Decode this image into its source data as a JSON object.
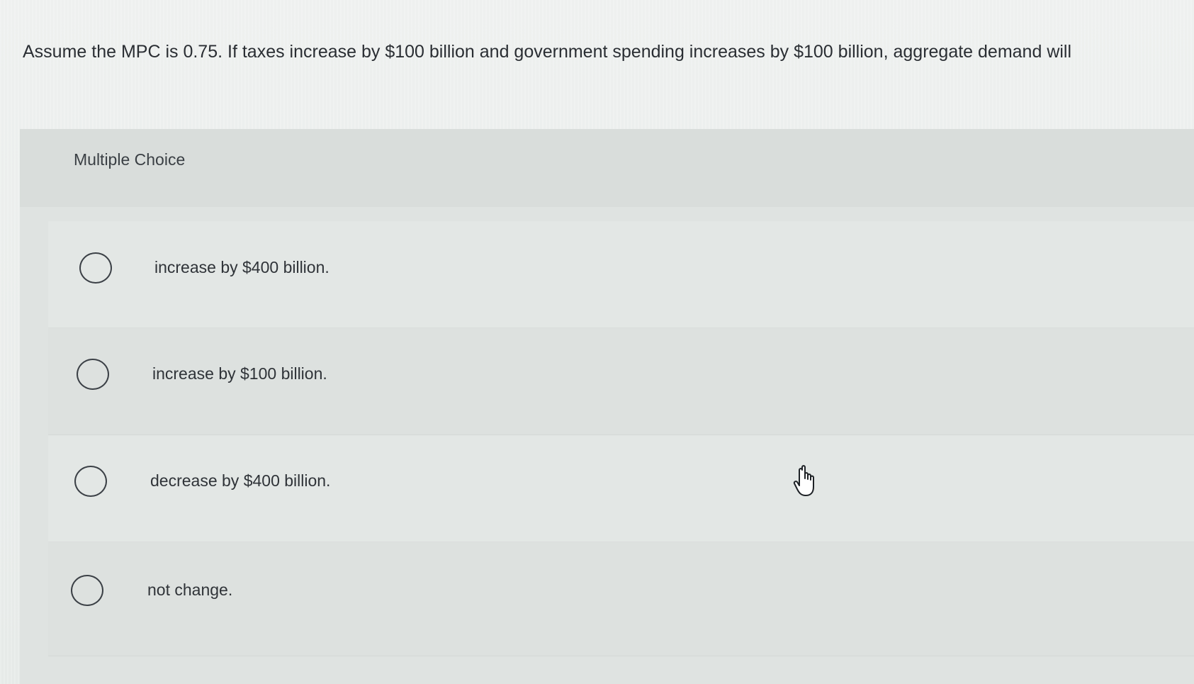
{
  "question": {
    "text": "Assume the MPC is 0.75. If taxes increase by $100 billion and government spending increases by $100 billion, aggregate demand will"
  },
  "multiple_choice": {
    "label": "Multiple Choice",
    "options": [
      {
        "label": "increase by $400 billion."
      },
      {
        "label": "increase by $100 billion."
      },
      {
        "label": "decrease by $400 billion."
      },
      {
        "label": "not change."
      }
    ]
  },
  "cursor": {
    "icon": "hand-pointer-icon"
  }
}
